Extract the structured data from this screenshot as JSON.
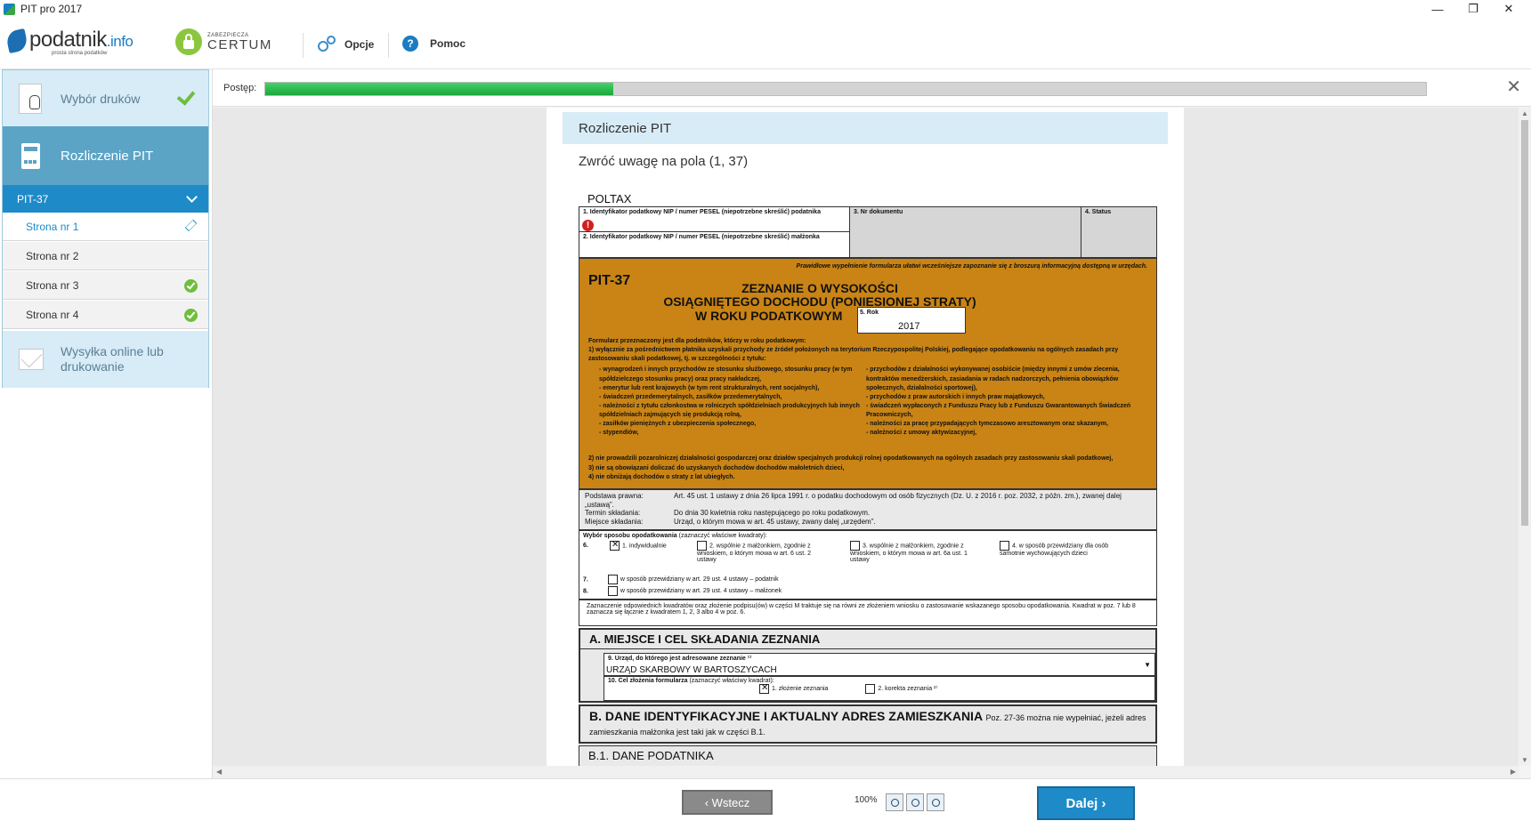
{
  "window": {
    "title": "PIT pro 2017",
    "controls": [
      "—",
      "❐",
      "✕"
    ]
  },
  "toolbar": {
    "logo_main": "podatnik",
    "logo_suffix": ".info",
    "logo_tagline": "prosta strona podatków",
    "certum_small": "ZABEZPIECZA",
    "certum_big": "CERTUM",
    "options_label": "Opcje",
    "help_label": "Pomoc",
    "help_glyph": "?"
  },
  "sidebar": {
    "step1": {
      "label": "Wybór druków",
      "done": true
    },
    "step2": {
      "label": "Rozliczenie PIT"
    },
    "group": {
      "label": "PIT-37"
    },
    "pages": [
      {
        "label": "Strona nr 1",
        "state": "active"
      },
      {
        "label": "Strona nr 2",
        "state": "none"
      },
      {
        "label": "Strona nr 3",
        "state": "done"
      },
      {
        "label": "Strona nr 4",
        "state": "done"
      }
    ],
    "step3": {
      "label": "Wysyłka online lub drukowanie"
    }
  },
  "progress": {
    "label": "Postęp:",
    "value": 0.3
  },
  "content": {
    "section_title": "Rozliczenie PIT",
    "attention_note": "Zwróć uwagę na pola (1, 37)"
  },
  "form": {
    "header": "POLTAX",
    "field1_label": "1. Identyfikator podatkowy NIP / numer PESEL (niepotrzebne skreślić) podatnika",
    "field2_label": "2. Identyfikator podatkowy NIP / numer PESEL (niepotrzebne skreślić) małżonka",
    "field3_label": "3. Nr dokumentu",
    "field4_label": "4. Status",
    "notice": "Prawidłowe wypełnienie formularza ułatwi wcześniejsze zapoznanie się z broszurą informacyjną dostępną w urzędach.",
    "code": "PIT-37",
    "title_lines": [
      "ZEZNANIE O WYSOKOŚCI",
      "OSIĄGNIĘTEGO DOCHODU (PONIESIONEJ STRATY)",
      "W ROKU PODATKOWYM"
    ],
    "year_label": "5. Rok",
    "year_value": "2017",
    "purpose_intro": "Formularz przeznaczony jest dla podatników, którzy w roku podatkowym:",
    "purpose_1": "1) wyłącznie za pośrednictwem płatnika uzyskali przychody ze źródeł położonych na terytorium Rzeczypospolitej Polskiej, podlegające opodatkowaniu na ogólnych zasadach przy zastosowaniu skali podatkowej, tj. w szczególności z tytułu:",
    "left_items": [
      "- wynagrodzeń i innych przychodów ze stosunku służbowego, stosunku pracy (w tym spółdzielczego stosunku pracy) oraz pracy nakładczej,",
      "- emerytur lub rent krajowych (w tym rent strukturalnych, rent socjalnych),",
      "- świadczeń przedemerytalnych, zasiłków przedemerytalnych,",
      "- należności z tytułu członkostwa w rolniczych spółdzielniach produkcyjnych lub innych spółdzielniach zajmujących się produkcją rolną,",
      "- zasiłków pieniężnych z ubezpieczenia społecznego,",
      "- stypendiów,"
    ],
    "right_items": [
      "- przychodów z działalności wykonywanej osobiście (między innymi z umów zlecenia, kontraktów menedżerskich, zasiadania w radach nadzorczych, pełnienia obowiązków społecznych, działalności sportowej),",
      "- przychodów z praw autorskich i innych praw majątkowych,",
      "- świadczeń wypłaconych z Funduszu Pracy lub z Funduszu Gwarantowanych Świadczeń Pracowniczych,",
      "- należności za pracę przypadających tymczasowo aresztowanym oraz skazanym,",
      "- należności z umowy aktywizacyjnej,"
    ],
    "purpose_2": "2) nie prowadzili pozarolniczej działalności gospodarczej oraz działów specjalnych produkcji rolnej opodatkowanych na ogólnych zasadach przy zastosowaniu skali podatkowej,",
    "purpose_3": "3) nie są obowiązani doliczać do uzyskanych dochodów dochodów małoletnich dzieci,",
    "purpose_4": "4) nie obniżają dochodów o straty z lat ubiegłych.",
    "legal_basis_label": "Podstawa prawna:",
    "legal_basis_value": "Art. 45 ust. 1 ustawy z dnia 26 lipca 1991 r. o podatku dochodowym od osób fizycznych (Dz. U. z 2016 r. poz. 2032, z późn. zm.), zwanej dalej „ustawą”.",
    "deadline_label": "Termin składania:",
    "deadline_value": "Do dnia 30 kwietnia roku następującego po roku podatkowym.",
    "place_label": "Miejsce składania:",
    "place_value": "Urząd, o którym mowa w art. 45 ustawy, zwany dalej „urzędem”.",
    "choice_title": "Wybór sposobu opodatkowania",
    "choice_hint": "(zaznaczyć właściwe kwadraty):",
    "choice_opt1": "1. indywidualnie",
    "choice_opt2": "2. wspólnie z małżonkiem, zgodnie z wnioskiem, o którym mowa w art. 6 ust. 2 ustawy",
    "choice_opt3": "3. wspólnie z małżonkiem, zgodnie z wnioskiem, o którym mowa w art. 6a ust. 1 ustawy",
    "choice_opt4": "4. w sposób przewidziany dla osób samotnie wychowujących dzieci",
    "choice7": "w sposób przewidziany w art. 29 ust. 4 ustawy – podatnik",
    "choice8": "w sposób przewidziany w art. 29 ust. 4 ustawy – małżonek",
    "choice_note": "Zaznaczenie odpowiednich kwadratów oraz złożenie podpisu(ów) w części M traktuje się na równi ze złożeniem wniosku o zastosowanie wskazanego sposobu opodatkowania. Kwadrat w poz. 7 lub 8 zaznacza się łącznie z kwadratem 1, 2, 3 albo 4 w poz. 6.",
    "sectionA": "A. MIEJSCE I CEL SKŁADANIA ZEZNANIA",
    "field9_label": "9. Urząd, do którego jest adresowane zeznanie ¹⁾",
    "field9_value": "URZĄD SKARBOWY W BARTOSZYCACH",
    "field10_label": "10. Cel złożenia formularza",
    "field10_hint": "(zaznaczyć właściwy kwadrat):",
    "field10_opt1": "1. złożenie zeznania",
    "field10_opt2": "2. korekta zeznania ²⁾",
    "sectionB": "B. DANE IDENTYFIKACYJNE I AKTUALNY ADRES ZAMIESZKANIA",
    "sectionB_note": "Poz. 27-36 można nie wypełniać, jeżeli adres zamieszkania małżonka jest taki jak w części B.1.",
    "sectionB1": "B.1. DANE PODATNIKA"
  },
  "bottom": {
    "back_label": "‹  Wstecz",
    "zoom_label": "100%",
    "next_label": "Dalej  ›"
  },
  "colors": {
    "accent": "#1e8bc8",
    "progress": "#1aa63c",
    "form_orange": "#c98415"
  }
}
